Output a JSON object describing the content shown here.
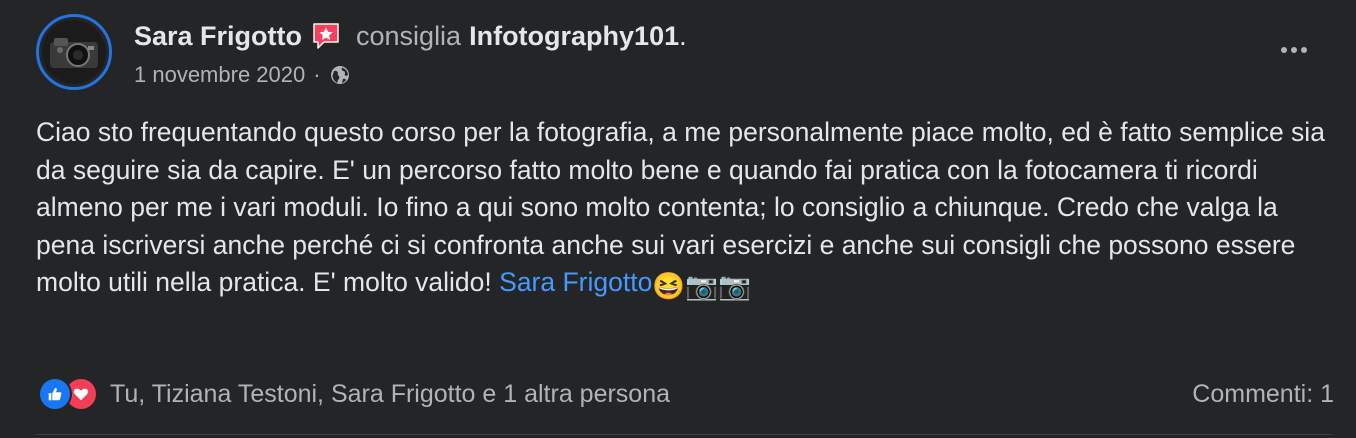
{
  "post": {
    "author": "Sara Frigotto",
    "verb": "consiglia",
    "page_name": "Infotography101",
    "page_name_suffix": ".",
    "date": "1 novembre 2020",
    "meta_separator": "·",
    "audience_icon": "globe-icon",
    "badge_icon": "recommendation-star-icon",
    "more_icon": "more-options-icon",
    "body_text": "Ciao sto frequentando questo corso per la fotografia, a me personalmente piace molto, ed è fatto semplice sia da seguire sia da capire. E' un percorso fatto molto bene e quando fai pratica con la fotocamera ti ricordi almeno per me i vari moduli. Io fino a qui sono molto contenta; lo consiglio a chiunque. Credo che valga la pena iscriversi anche perché ci si confronta anche sui vari esercizi e anche sui consigli che possono essere molto utili nella pratica. E' molto valido! ",
    "body_mention": "Sara Frigotto",
    "body_emojis": "😆📷📷"
  },
  "reactions": {
    "icons": [
      "like-icon",
      "love-icon"
    ],
    "summary": "Tu, Tiziana Testoni, Sara Frigotto e 1 altra persona",
    "comments": "Commenti: 1"
  },
  "colors": {
    "background": "#242526",
    "primary_text": "#e4e6eb",
    "secondary_text": "#b0b3b8",
    "link": "#4599ff",
    "like_blue": "#1877f2",
    "love_red": "#f33e58",
    "badge_pink": "#f3425f"
  }
}
